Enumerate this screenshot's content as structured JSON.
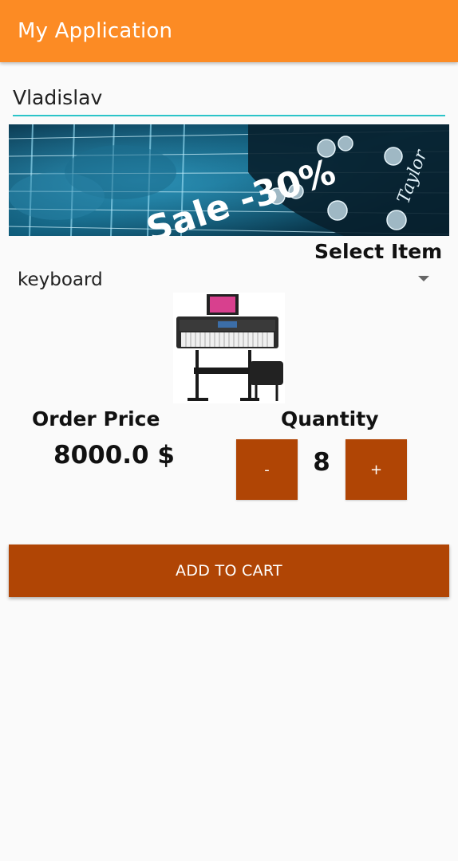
{
  "app": {
    "title": "My Application"
  },
  "name_field": {
    "value": "Vladislav"
  },
  "banner": {
    "text": "Sale -30%",
    "brand": "Taylor",
    "icon": "guitar-banner-image"
  },
  "select": {
    "label": "Select Item",
    "selected": "keyboard",
    "icon": "dropdown-arrow-icon"
  },
  "product": {
    "icon": "keyboard-product-image"
  },
  "order": {
    "label": "Order Price",
    "price": "8000.0 $"
  },
  "quantity": {
    "label": "Quantity",
    "value": "8",
    "minus": "-",
    "plus": "+"
  },
  "cart": {
    "button": "ADD TO CART"
  },
  "colors": {
    "appbar": "#fc8b24",
    "accent": "#2bc4c8",
    "button": "#b04505"
  }
}
